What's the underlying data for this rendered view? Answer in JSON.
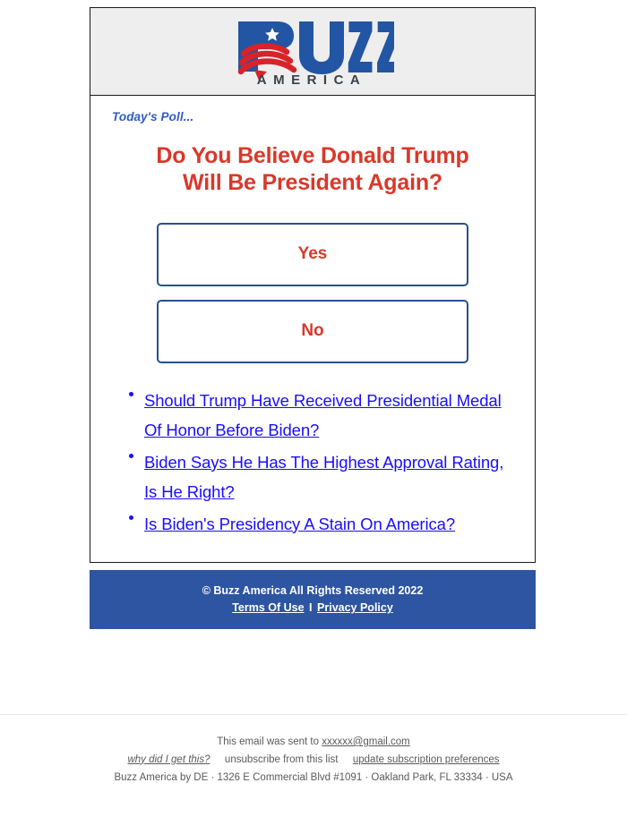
{
  "logo": {
    "brand_main": "BUZZ",
    "brand_sub": "AMERICA",
    "star_icon": "star-icon",
    "swoosh_icon": "flag-swoosh-icon",
    "colors": {
      "blue": "#2255a4",
      "red": "#d8232a",
      "sub_gray": "#3b4147"
    }
  },
  "header": {
    "background": "#eeeeee"
  },
  "poll": {
    "kicker": "Today's Poll...",
    "question": "Do You Believe Donald Trump Will Be President Again?",
    "question_line1": "Do You Believe Donald Trump",
    "question_line2": "Will Be President Again?",
    "options": [
      {
        "label": "Yes"
      },
      {
        "label": "No"
      }
    ],
    "accent_red": "#d9382a",
    "accent_blue": "#26528f"
  },
  "articles": [
    {
      "title": "Should Trump Have Received Presidential Medal Of Honor Before Biden?"
    },
    {
      "title": "Biden Says He Has The Highest Approval Rating, Is He Right?"
    },
    {
      "title": "Is Biden's Presidency A Stain On America?"
    }
  ],
  "brand_footer": {
    "copyright": "© Buzz America All Rights Reserved 2022",
    "terms_label": "Terms Of Use",
    "separator": "I",
    "privacy_label": "Privacy Policy",
    "background": "#2d55a1"
  },
  "mail_footer": {
    "sent_to_prefix": "This email was sent to",
    "recipient_email": "xxxxxx@gmail.com",
    "why_link": "why did I get this?",
    "unsubscribe_link": "unsubscribe from this list",
    "preferences_link": "update subscription preferences",
    "address": "Buzz America by DE · 1326 E Commercial Blvd #1091 · Oakland Park, FL 33334 · USA"
  }
}
